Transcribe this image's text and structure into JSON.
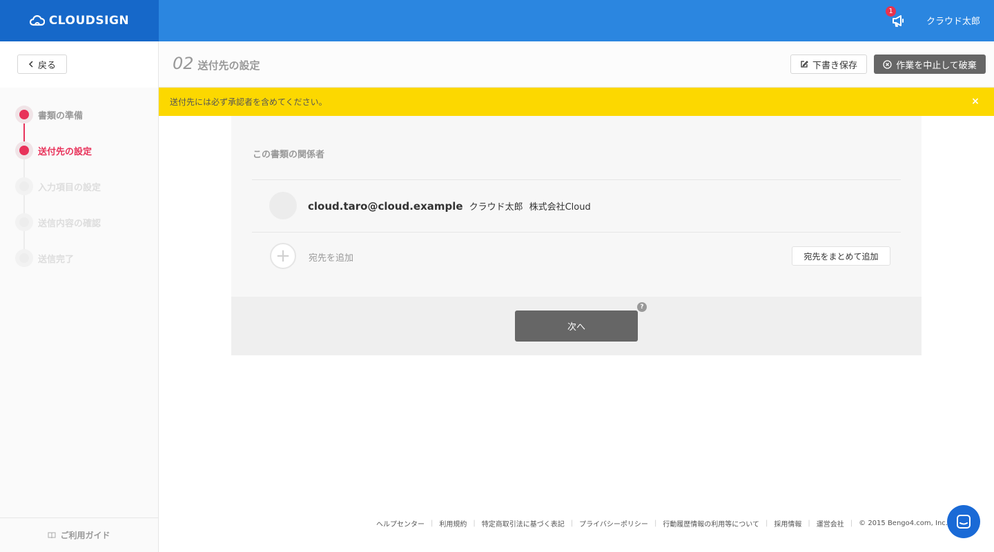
{
  "header": {
    "logo_text": "CLOUDSIGN",
    "notification_count": "1",
    "user_name": "クラウド太郎"
  },
  "subheader": {
    "back_label": "戻る",
    "step_number": "02",
    "step_title": "送付先の設定",
    "draft_label": "下書き保存",
    "abort_label": "作業を中止して破棄"
  },
  "sidebar": {
    "steps": [
      {
        "label": "書類の準備",
        "state": "done"
      },
      {
        "label": "送付先の設定",
        "state": "current"
      },
      {
        "label": "入力項目の設定",
        "state": "pending"
      },
      {
        "label": "送信内容の確認",
        "state": "pending"
      },
      {
        "label": "送信完了",
        "state": "pending"
      }
    ],
    "guide_label": "ご利用ガイド"
  },
  "alert": {
    "message": "送付先には必ず承認者を含めてください。",
    "close_label": "×"
  },
  "card": {
    "title": "この書類の関係者",
    "recipient": {
      "email": "cloud.taro@cloud.example",
      "name": "クラウド太郎",
      "company": "株式会社Cloud"
    },
    "add_plus": "+",
    "add_label": "宛先を追加",
    "bulk_add_label": "宛先をまとめて追加",
    "next_label": "次へ",
    "help_label": "?"
  },
  "footer": {
    "links": [
      "ヘルプセンター",
      "利用規約",
      "特定商取引法に基づく表記",
      "プライバシーポリシー",
      "行動履歴情報の利用等について",
      "採用情報",
      "運営会社"
    ],
    "copyright": "© 2015 Bengo4.com, Inc."
  },
  "colors": {
    "header": "#2b86e0",
    "logo_bg": "#1668c9",
    "accent": "#e8325a",
    "alert": "#fcd800",
    "chat": "#1a6ad6"
  }
}
